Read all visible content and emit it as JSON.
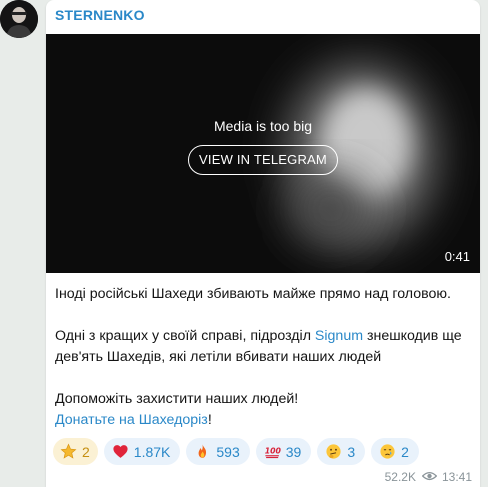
{
  "channel": {
    "name": "STERNENKO"
  },
  "media": {
    "notice": "Media is too big",
    "view_button": "VIEW IN TELEGRAM",
    "duration": "0:41"
  },
  "message": {
    "line1": "Іноді російські Шахеди збивають майже прямо над головою.",
    "p2_before": "Одні з кращих у своїй справі, підрозділ ",
    "p2_link": "Signum",
    "p2_after": " знешкодив ще дев'ять Шахедів, які летіли вбивати наших людей",
    "line3": "Допоможіть захистити наших людей!",
    "donate_link": "Донатьте на Шахедоріз",
    "donate_suffix": "!"
  },
  "reactions": [
    {
      "icon": "star-icon",
      "count": "2"
    },
    {
      "icon": "heart-icon",
      "count": "1.87K"
    },
    {
      "icon": "fire-icon",
      "count": "593"
    },
    {
      "icon": "hundred-icon",
      "count": "39"
    },
    {
      "icon": "thinking-face-icon",
      "count": "3"
    },
    {
      "icon": "crying-face-icon",
      "count": "2"
    }
  ],
  "meta": {
    "views": "52.2K",
    "time": "13:41"
  },
  "colors": {
    "accent": "#2a88c8",
    "reaction_bg": "#e9f2fb",
    "paid_reaction_bg": "#fbf1d4"
  }
}
